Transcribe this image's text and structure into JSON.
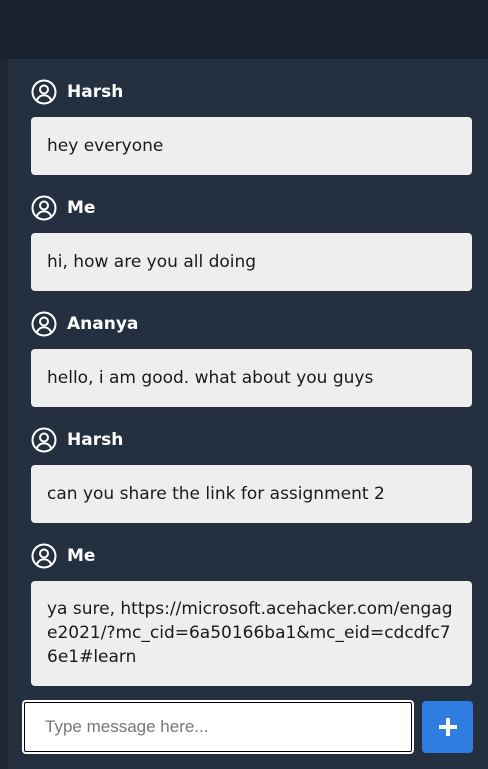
{
  "messages": [
    {
      "sender": "Harsh",
      "text": "hey everyone"
    },
    {
      "sender": "Me",
      "text": "hi, how are you all doing"
    },
    {
      "sender": "Ananya",
      "text": "hello, i am good. what about you guys"
    },
    {
      "sender": "Harsh",
      "text": "can you share the link for assignment 2"
    },
    {
      "sender": "Me",
      "text": "ya sure, https://microsoft.acehacker.com/engage2021/?mc_cid=6a50166ba1&mc_eid=cdcdfc76e1#learn"
    }
  ],
  "composer": {
    "placeholder": "Type message here...",
    "value": ""
  },
  "icons": {
    "sender": "user-circle-icon",
    "send": "plus-icon"
  },
  "colors": {
    "page_bg": "#1b2331",
    "panel_bg": "#242f3f",
    "bubble_bg": "#eeeeee",
    "accent": "#2f7de1"
  }
}
